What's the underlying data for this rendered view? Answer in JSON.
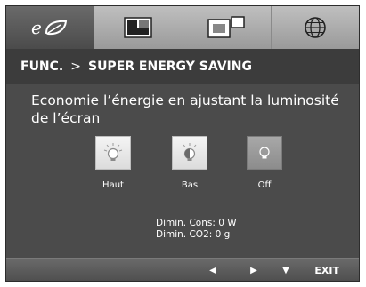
{
  "tabs": [
    {
      "icon": "eco-leaf-icon"
    },
    {
      "icon": "picture-icon"
    },
    {
      "icon": "pip-icon"
    },
    {
      "icon": "globe-icon"
    }
  ],
  "breadcrumb": {
    "func": "FUNC.",
    "separator": ">",
    "current": "SUPER ENERGY SAVING"
  },
  "description": "Economie l’énergie en ajustant la luminosité de l’écran",
  "options": [
    {
      "label": "Haut",
      "icon": "bulb-high-icon"
    },
    {
      "label": "Bas",
      "icon": "bulb-low-icon"
    },
    {
      "label": "Off",
      "icon": "bulb-off-icon",
      "selected": true
    }
  ],
  "stats": {
    "cons_label": "Dimin. Cons:",
    "cons_value": "0 W",
    "co2_label": "Dimin. CO2:",
    "co2_value": "0 g"
  },
  "bottom_nav": {
    "left": "◀",
    "right": "▶",
    "down": "▼",
    "exit": "EXIT"
  },
  "colors": {
    "panel": "#4b4b4b",
    "topbar": "#b0b0b0",
    "text": "#ffffff",
    "selected_option": "#999999"
  }
}
